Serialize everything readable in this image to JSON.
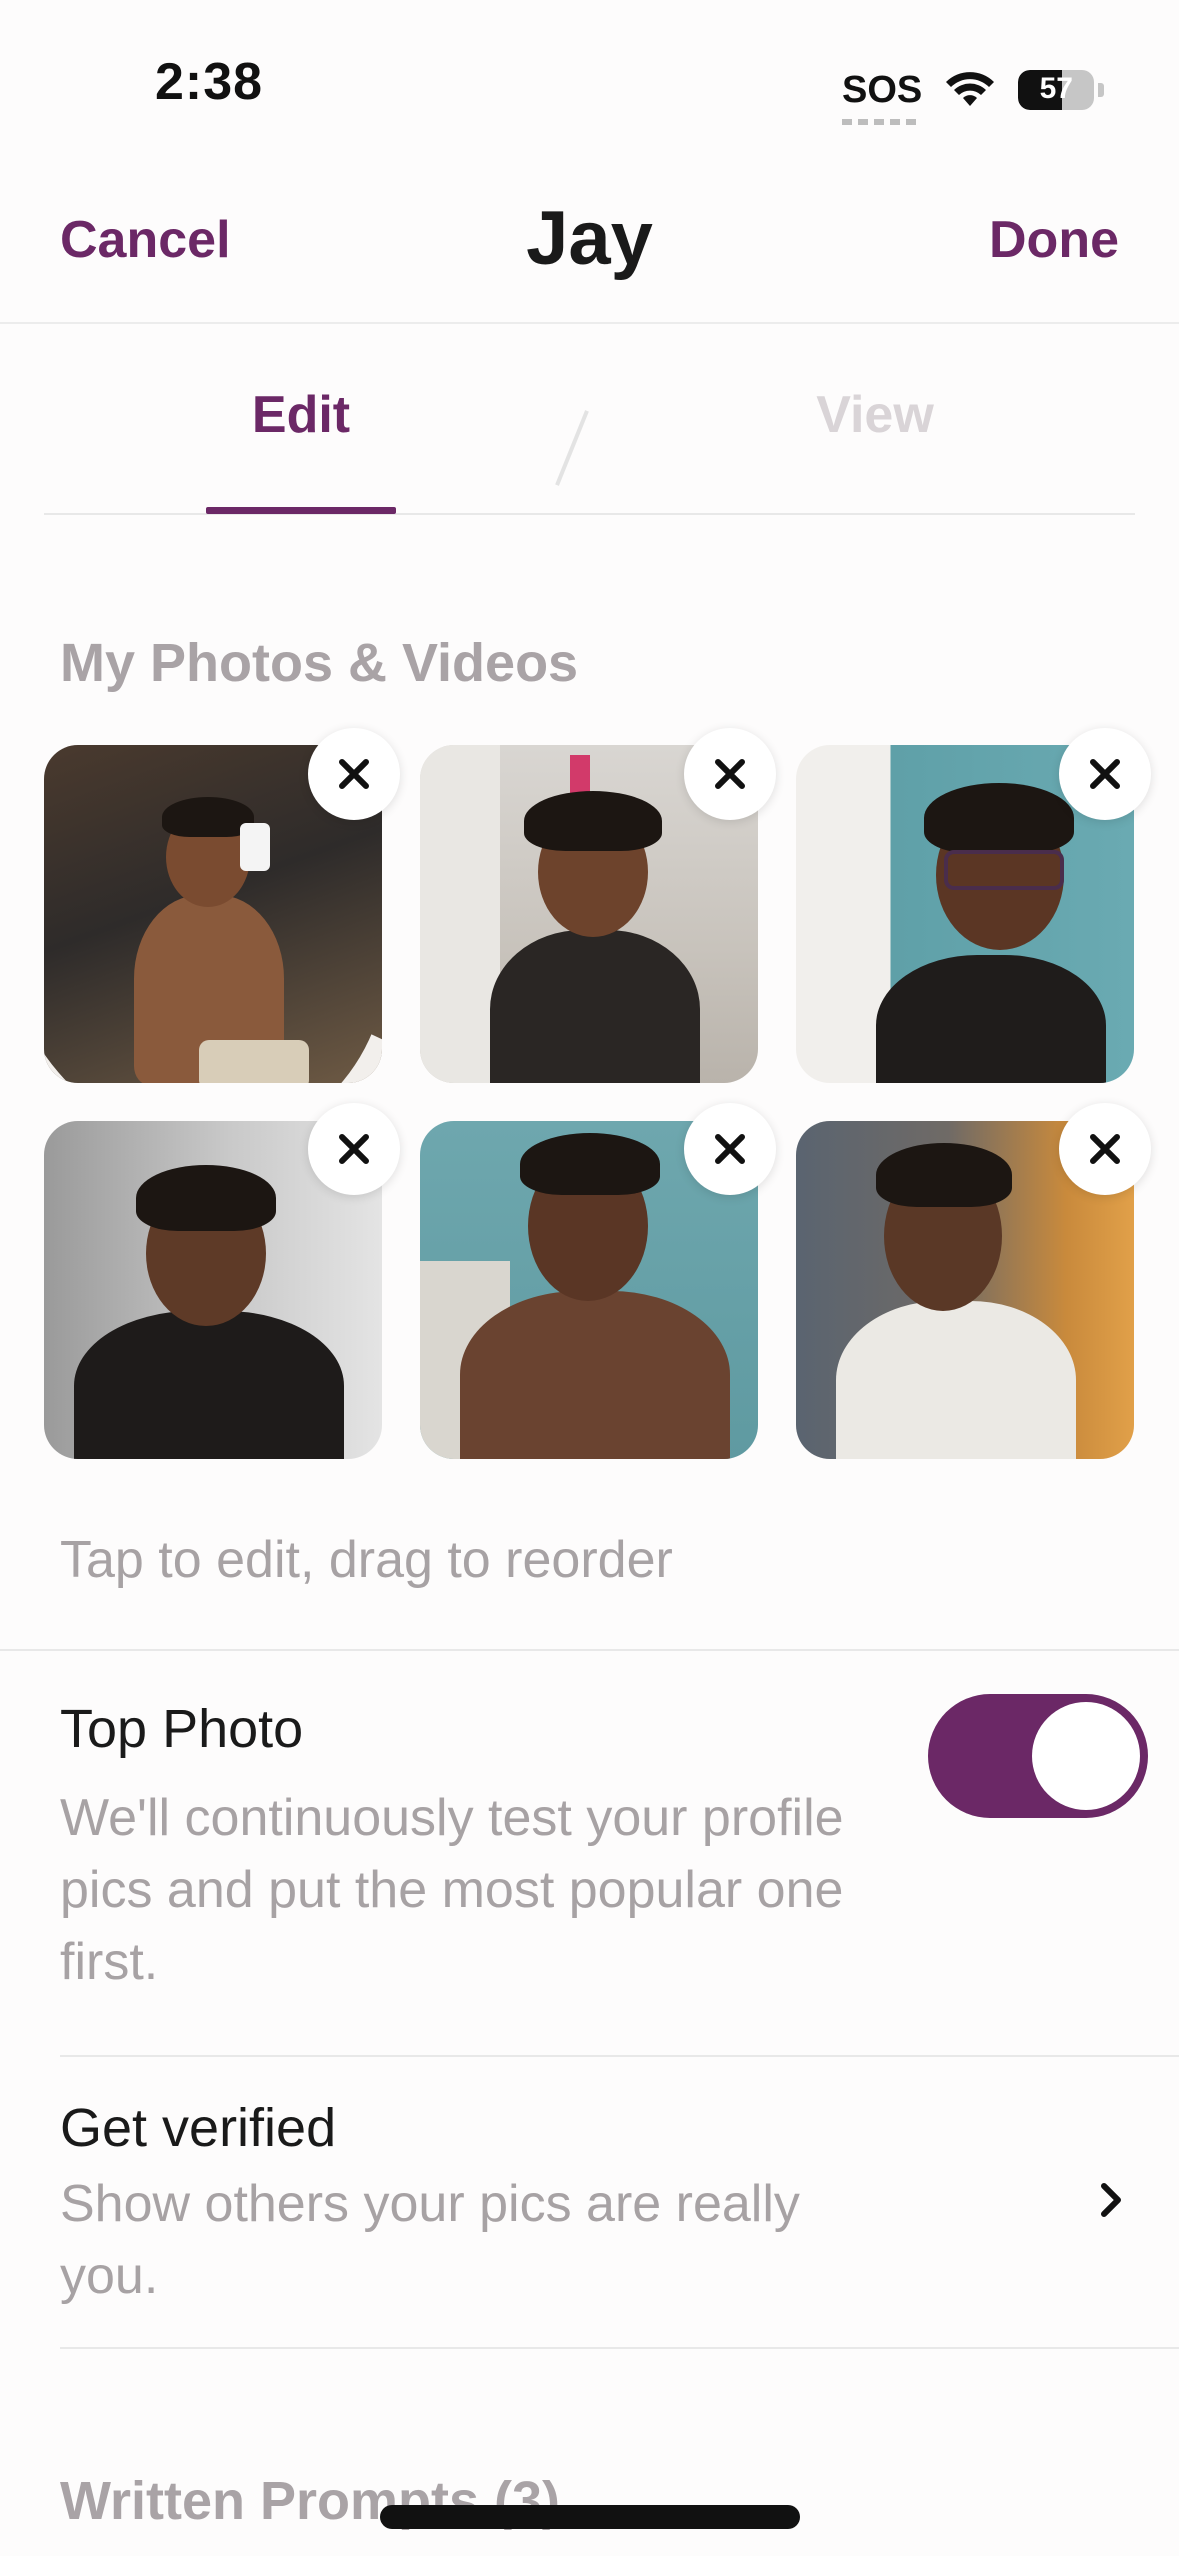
{
  "status_bar": {
    "time": "2:38",
    "sos": "SOS",
    "battery_level": "57",
    "battery_fill_fraction": 0.57
  },
  "header": {
    "cancel_label": "Cancel",
    "title": "Jay",
    "done_label": "Done"
  },
  "tabs": {
    "edit_label": "Edit",
    "view_label": "View",
    "selected": "Edit"
  },
  "photos_section": {
    "title": "My Photos & Videos",
    "photo_count": 6,
    "hint": "Tap to edit, drag to reorder"
  },
  "top_photo": {
    "title": "Top Photo",
    "description": "We'll continuously test your profile pics and put the most popular one first.",
    "enabled": true
  },
  "get_verified": {
    "title": "Get verified",
    "description": "Show others your pics are really you."
  },
  "written_prompts": {
    "title": "Written Prompts (3)"
  },
  "colors": {
    "accent": "#6b2866",
    "muted_text": "#a7a2a4",
    "inactive_tab": "#d9d4d7"
  },
  "icons": {
    "remove": "close-icon",
    "chevron": "chevron-right-icon",
    "wifi": "wifi-icon",
    "battery": "battery-icon"
  }
}
